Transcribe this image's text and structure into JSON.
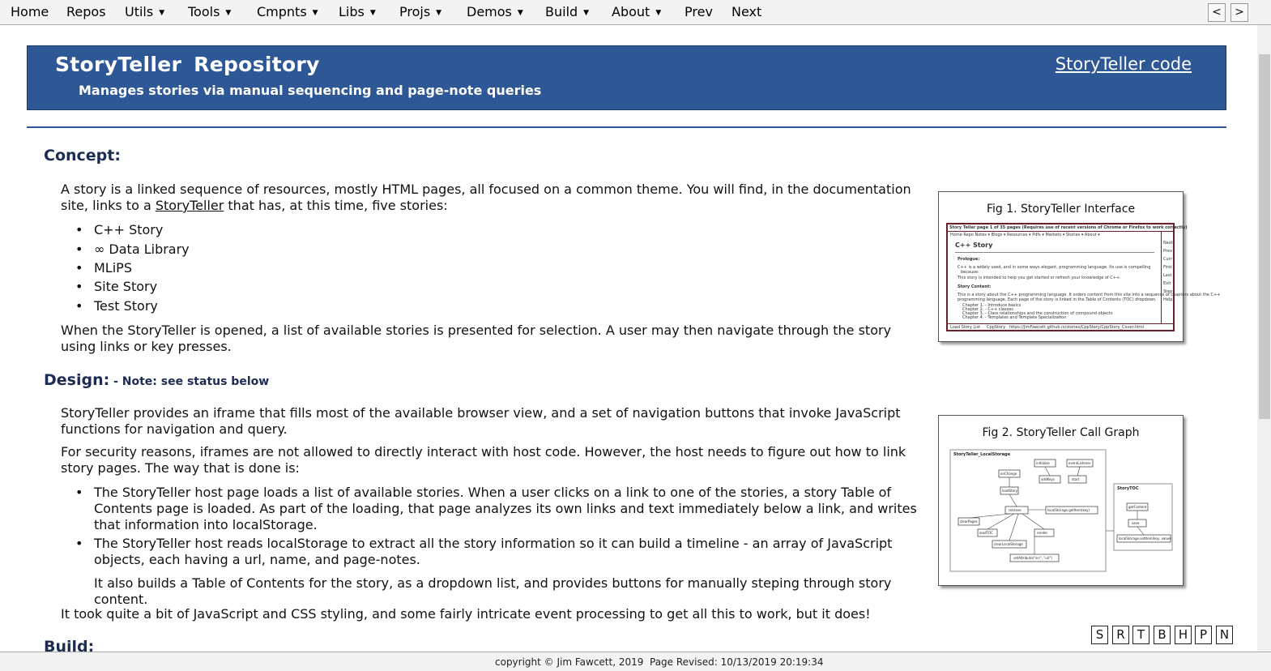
{
  "menu": {
    "items": [
      {
        "label": "Home",
        "dropdown": false
      },
      {
        "label": "Repos",
        "dropdown": false
      },
      {
        "label": "Utils",
        "dropdown": true
      },
      {
        "label": "Tools",
        "dropdown": true
      },
      {
        "label": "Cmpnts",
        "dropdown": true
      },
      {
        "label": "Libs",
        "dropdown": true
      },
      {
        "label": "Projs",
        "dropdown": true
      },
      {
        "label": "Demos",
        "dropdown": true
      },
      {
        "label": "Build",
        "dropdown": true
      },
      {
        "label": "About",
        "dropdown": true
      },
      {
        "label": "Prev",
        "dropdown": false
      },
      {
        "label": "Next",
        "dropdown": false
      }
    ],
    "caret": "▼",
    "prev_arrow": "<",
    "next_arrow": ">"
  },
  "banner": {
    "title": "StoryTeller Repository",
    "subtitle": "Manages stories via manual sequencing and page-note queries",
    "code_link": "StoryTeller code",
    "color": "#2e5795"
  },
  "concept": {
    "heading": "Concept:",
    "intro_before_link": "A story is a linked sequence of resources, mostly HTML pages, all focused on a common theme. You will find, in the documentation site, links to a ",
    "intro_link": "StoryTeller",
    "intro_after_link": " that has, at this time, five stories:",
    "stories": [
      "C++ Story",
      "∞ Data Library",
      "MLiPS",
      "Site Story",
      "Test Story"
    ],
    "outro": "When the StoryTeller is opened, a list of available stories is presented for selection. A user may then navigate through the story using links or key presses."
  },
  "design": {
    "heading": "Design:",
    "note": " - Note: see status below",
    "para1": "StoryTeller provides an iframe that fills most of the available browser view, and a set of navigation buttons that invoke JavaScript functions for navigation and query.",
    "para2": "For security reasons, iframes are not allowed to directly interact with host code. However, the host needs to figure out how to link story pages. The way that is done is:",
    "bullets": [
      "The StoryTeller host page loads a list of available stories. When a user clicks on a link to one of the stories, a story Table of Contents page is loaded. As part of the loading, that page analyzes its own links and text immediately below a link, and writes that information into localStorage.",
      "The StoryTeller host reads localStorage to extract all the story information so it can build a timeline - an array of JavaScript objects, each having a url, name, and page-notes."
    ],
    "bullet_followup": "It also builds a Table of Contents for the story, as a dropdown list, and provides buttons for manually steping through story content.",
    "closing": "It took quite a bit of JavaScript and CSS styling, and some fairly intricate event processing to get all this to work, but it does!"
  },
  "build": {
    "heading": "Build:"
  },
  "fig1": {
    "caption": "Fig 1. StoryTeller Interface",
    "topbar": "Story Teller page  1  of  35 pages      (Requires use of recent versions of Chrome or Firefox to work correctly)",
    "nav": "Home   Repo   Notes ▾   Blogs ▾   Resources ▾   Pdfs ▾   Markets ▾   Stories ▾   About ▾",
    "page_title": "C++ Story",
    "prologue_label": "Prologue:",
    "prologue_text": "C++ is a widely used, and in some ways elegant, programming language. Its use is compelling",
    "prologue_text2": "because:",
    "prologue_text3": "This story is intended to help you get started or refresh your knowledge of C++.",
    "content_label": "Story Content:",
    "content_text": "This is a story about the C++ programming language. It orders content from this site into a sequence of chapters about the C++",
    "content_text2": "programming language. Each page of the story is linked in the Table of Contents (TOC) dropdown.",
    "chapters": [
      "Chapter 1. - Introduce basics",
      "Chapter 2. - C++ classes",
      "Chapter 3. - Class relationships and the construction of compound objects",
      "Chapter 4. - Templates and Template Specialization"
    ],
    "side_buttons": [
      "Next",
      "Prev",
      "Curr",
      "First",
      "Last",
      "Exit",
      "Step",
      "Help"
    ],
    "bottom_left": "Load Story List",
    "bottom_story": "CppStory",
    "bottom_url": "https://JimFawcett.github.io/stories/CppStory/CppStory_Cover.html"
  },
  "fig2": {
    "caption": "Fig 2. StoryTeller Call Graph",
    "group1": "StoryTeller_LocalStorage",
    "group2": "StoryTOC",
    "nodes": [
      "initialize",
      "eventListener",
      "onChange",
      "addKeys",
      "start",
      "loadStory",
      "retrieve",
      "localStorage.getItem(key)",
      "clearPages",
      "loadTOC",
      "render",
      "clearLocalStorage",
      "setAttribute(\"src\", \"url\")",
      "getContent",
      "save",
      "localStorage.setItem(key, value)"
    ]
  },
  "key_buttons": [
    "S",
    "R",
    "T",
    "B",
    "H",
    "P",
    "N"
  ],
  "footer": {
    "copyright": "copyright © Jim Fawcett, 2019",
    "revised": "Page Revised: 10/13/2019 20:19:34"
  }
}
